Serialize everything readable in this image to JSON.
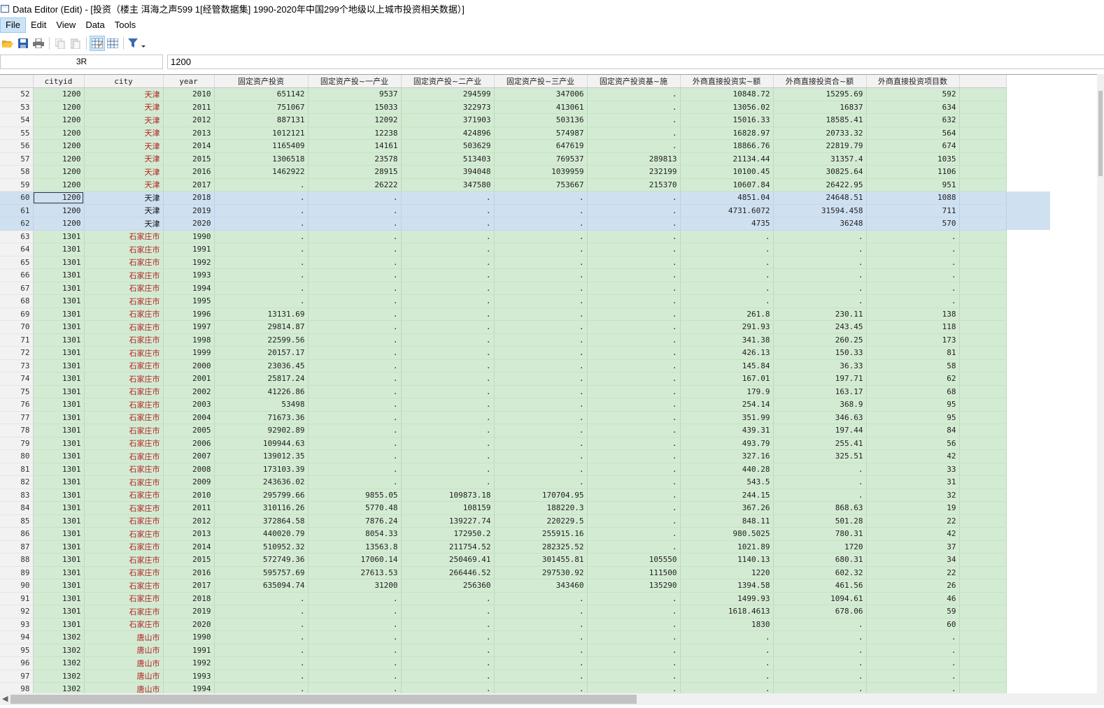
{
  "window": {
    "title": "Data Editor (Edit) - [投资（楼主 洱海之声599 1[经管数据集] 1990-2020年中国299个地级以上城市投资相关数据）]"
  },
  "menu": {
    "items": [
      "File",
      "Edit",
      "View",
      "Data",
      "Tools"
    ]
  },
  "toolbar": {
    "icons": [
      "open-icon",
      "save-icon",
      "print-icon",
      "copy-icon",
      "paste-icon",
      "data-editor-edit-icon",
      "data-editor-browse-icon",
      "filter-icon"
    ]
  },
  "cell": {
    "ref": "3R",
    "value": "1200"
  },
  "columns": [
    "cityid",
    "city",
    "year",
    "固定资产投资",
    "固定资产投~一产业",
    "固定资产投~二产业",
    "固定资产投~三产业",
    "固定资产投资基~施",
    "外商直接投资实~额",
    "外商直接投资合~额",
    "外商直接投资项目数"
  ],
  "rows": [
    {
      "n": "52",
      "cells": [
        "1200",
        "天津",
        "2010",
        "651142",
        "9537",
        "294599",
        "347006",
        ".",
        "10848.72",
        "15295.69",
        "592"
      ]
    },
    {
      "n": "53",
      "cells": [
        "1200",
        "天津",
        "2011",
        "751067",
        "15033",
        "322973",
        "413061",
        ".",
        "13056.02",
        "16837",
        "634"
      ]
    },
    {
      "n": "54",
      "cells": [
        "1200",
        "天津",
        "2012",
        "887131",
        "12092",
        "371903",
        "503136",
        ".",
        "15016.33",
        "18585.41",
        "632"
      ]
    },
    {
      "n": "55",
      "cells": [
        "1200",
        "天津",
        "2013",
        "1012121",
        "12238",
        "424896",
        "574987",
        ".",
        "16828.97",
        "20733.32",
        "564"
      ]
    },
    {
      "n": "56",
      "cells": [
        "1200",
        "天津",
        "2014",
        "1165409",
        "14161",
        "503629",
        "647619",
        ".",
        "18866.76",
        "22819.79",
        "674"
      ]
    },
    {
      "n": "57",
      "cells": [
        "1200",
        "天津",
        "2015",
        "1306518",
        "23578",
        "513403",
        "769537",
        "289813",
        "21134.44",
        "31357.4",
        "1035"
      ]
    },
    {
      "n": "58",
      "cells": [
        "1200",
        "天津",
        "2016",
        "1462922",
        "28915",
        "394048",
        "1039959",
        "232199",
        "10100.45",
        "30825.64",
        "1106"
      ]
    },
    {
      "n": "59",
      "cells": [
        "1200",
        "天津",
        "2017",
        ".",
        "26222",
        "347580",
        "753667",
        "215370",
        "10607.84",
        "26422.95",
        "951"
      ]
    },
    {
      "n": "60",
      "sel": true,
      "cur": true,
      "cells": [
        "1200",
        "天津",
        "2018",
        ".",
        ".",
        ".",
        ".",
        ".",
        "4851.04",
        "24648.51",
        "1088"
      ]
    },
    {
      "n": "61",
      "sel": true,
      "cells": [
        "1200",
        "天津",
        "2019",
        ".",
        ".",
        ".",
        ".",
        ".",
        "4731.6072",
        "31594.458",
        "711"
      ]
    },
    {
      "n": "62",
      "sel": true,
      "cells": [
        "1200",
        "天津",
        "2020",
        ".",
        ".",
        ".",
        ".",
        ".",
        "4735",
        "36248",
        "570"
      ]
    },
    {
      "n": "63",
      "cells": [
        "1301",
        "石家庄市",
        "1990",
        ".",
        ".",
        ".",
        ".",
        ".",
        ".",
        ".",
        "."
      ]
    },
    {
      "n": "64",
      "cells": [
        "1301",
        "石家庄市",
        "1991",
        ".",
        ".",
        ".",
        ".",
        ".",
        ".",
        ".",
        "."
      ]
    },
    {
      "n": "65",
      "cells": [
        "1301",
        "石家庄市",
        "1992",
        ".",
        ".",
        ".",
        ".",
        ".",
        ".",
        ".",
        "."
      ]
    },
    {
      "n": "66",
      "cells": [
        "1301",
        "石家庄市",
        "1993",
        ".",
        ".",
        ".",
        ".",
        ".",
        ".",
        ".",
        "."
      ]
    },
    {
      "n": "67",
      "cells": [
        "1301",
        "石家庄市",
        "1994",
        ".",
        ".",
        ".",
        ".",
        ".",
        ".",
        ".",
        "."
      ]
    },
    {
      "n": "68",
      "cells": [
        "1301",
        "石家庄市",
        "1995",
        ".",
        ".",
        ".",
        ".",
        ".",
        ".",
        ".",
        "."
      ]
    },
    {
      "n": "69",
      "cells": [
        "1301",
        "石家庄市",
        "1996",
        "13131.69",
        ".",
        ".",
        ".",
        ".",
        "261.8",
        "230.11",
        "138"
      ]
    },
    {
      "n": "70",
      "cells": [
        "1301",
        "石家庄市",
        "1997",
        "29814.87",
        ".",
        ".",
        ".",
        ".",
        "291.93",
        "243.45",
        "118"
      ]
    },
    {
      "n": "71",
      "cells": [
        "1301",
        "石家庄市",
        "1998",
        "22599.56",
        ".",
        ".",
        ".",
        ".",
        "341.38",
        "260.25",
        "173"
      ]
    },
    {
      "n": "72",
      "cells": [
        "1301",
        "石家庄市",
        "1999",
        "20157.17",
        ".",
        ".",
        ".",
        ".",
        "426.13",
        "150.33",
        "81"
      ]
    },
    {
      "n": "73",
      "cells": [
        "1301",
        "石家庄市",
        "2000",
        "23036.45",
        ".",
        ".",
        ".",
        ".",
        "145.84",
        "36.33",
        "58"
      ]
    },
    {
      "n": "74",
      "cells": [
        "1301",
        "石家庄市",
        "2001",
        "25817.24",
        ".",
        ".",
        ".",
        ".",
        "167.01",
        "197.71",
        "62"
      ]
    },
    {
      "n": "75",
      "cells": [
        "1301",
        "石家庄市",
        "2002",
        "41226.86",
        ".",
        ".",
        ".",
        ".",
        "179.9",
        "163.17",
        "68"
      ]
    },
    {
      "n": "76",
      "cells": [
        "1301",
        "石家庄市",
        "2003",
        "53498",
        ".",
        ".",
        ".",
        ".",
        "254.14",
        "368.9",
        "95"
      ]
    },
    {
      "n": "77",
      "cells": [
        "1301",
        "石家庄市",
        "2004",
        "71673.36",
        ".",
        ".",
        ".",
        ".",
        "351.99",
        "346.63",
        "95"
      ]
    },
    {
      "n": "78",
      "cells": [
        "1301",
        "石家庄市",
        "2005",
        "92902.89",
        ".",
        ".",
        ".",
        ".",
        "439.31",
        "197.44",
        "84"
      ]
    },
    {
      "n": "79",
      "cells": [
        "1301",
        "石家庄市",
        "2006",
        "109944.63",
        ".",
        ".",
        ".",
        ".",
        "493.79",
        "255.41",
        "56"
      ]
    },
    {
      "n": "80",
      "cells": [
        "1301",
        "石家庄市",
        "2007",
        "139012.35",
        ".",
        ".",
        ".",
        ".",
        "327.16",
        "325.51",
        "42"
      ]
    },
    {
      "n": "81",
      "cells": [
        "1301",
        "石家庄市",
        "2008",
        "173103.39",
        ".",
        ".",
        ".",
        ".",
        "440.28",
        ".",
        "33"
      ]
    },
    {
      "n": "82",
      "cells": [
        "1301",
        "石家庄市",
        "2009",
        "243636.02",
        ".",
        ".",
        ".",
        ".",
        "543.5",
        ".",
        "31"
      ]
    },
    {
      "n": "83",
      "cells": [
        "1301",
        "石家庄市",
        "2010",
        "295799.66",
        "9855.05",
        "109873.18",
        "170704.95",
        ".",
        "244.15",
        ".",
        "32"
      ]
    },
    {
      "n": "84",
      "cells": [
        "1301",
        "石家庄市",
        "2011",
        "310116.26",
        "5770.48",
        "108159",
        "188220.3",
        ".",
        "367.26",
        "868.63",
        "19"
      ]
    },
    {
      "n": "85",
      "cells": [
        "1301",
        "石家庄市",
        "2012",
        "372864.58",
        "7876.24",
        "139227.74",
        "220229.5",
        ".",
        "848.11",
        "501.28",
        "22"
      ]
    },
    {
      "n": "86",
      "cells": [
        "1301",
        "石家庄市",
        "2013",
        "440020.79",
        "8054.33",
        "172950.2",
        "255915.16",
        ".",
        "980.5025",
        "780.31",
        "42"
      ]
    },
    {
      "n": "87",
      "cells": [
        "1301",
        "石家庄市",
        "2014",
        "510952.32",
        "13563.8",
        "211754.52",
        "282325.52",
        ".",
        "1021.89",
        "1720",
        "37"
      ]
    },
    {
      "n": "88",
      "cells": [
        "1301",
        "石家庄市",
        "2015",
        "572749.36",
        "17060.14",
        "250469.41",
        "301455.81",
        "105550",
        "1140.13",
        "680.31",
        "34"
      ]
    },
    {
      "n": "89",
      "cells": [
        "1301",
        "石家庄市",
        "2016",
        "595757.69",
        "27613.53",
        "266446.52",
        "297530.92",
        "111500",
        "1220",
        "602.32",
        "22"
      ]
    },
    {
      "n": "90",
      "cells": [
        "1301",
        "石家庄市",
        "2017",
        "635094.74",
        "31200",
        "256360",
        "343460",
        "135290",
        "1394.58",
        "461.56",
        "26"
      ]
    },
    {
      "n": "91",
      "cells": [
        "1301",
        "石家庄市",
        "2018",
        ".",
        ".",
        ".",
        ".",
        ".",
        "1499.93",
        "1094.61",
        "46"
      ]
    },
    {
      "n": "92",
      "cells": [
        "1301",
        "石家庄市",
        "2019",
        ".",
        ".",
        ".",
        ".",
        ".",
        "1618.4613",
        "678.06",
        "59"
      ]
    },
    {
      "n": "93",
      "cells": [
        "1301",
        "石家庄市",
        "2020",
        ".",
        ".",
        ".",
        ".",
        ".",
        "1830",
        ".",
        "60"
      ]
    },
    {
      "n": "94",
      "cells": [
        "1302",
        "唐山市",
        "1990",
        ".",
        ".",
        ".",
        ".",
        ".",
        ".",
        ".",
        "."
      ]
    },
    {
      "n": "95",
      "cells": [
        "1302",
        "唐山市",
        "1991",
        ".",
        ".",
        ".",
        ".",
        ".",
        ".",
        ".",
        "."
      ]
    },
    {
      "n": "96",
      "cells": [
        "1302",
        "唐山市",
        "1992",
        ".",
        ".",
        ".",
        ".",
        ".",
        ".",
        ".",
        "."
      ]
    },
    {
      "n": "97",
      "cells": [
        "1302",
        "唐山市",
        "1993",
        ".",
        ".",
        ".",
        ".",
        ".",
        ".",
        ".",
        "."
      ]
    },
    {
      "n": "98",
      "cells": [
        "1302",
        "唐山市",
        "1994",
        ".",
        ".",
        ".",
        ".",
        ".",
        ".",
        ".",
        "."
      ]
    }
  ]
}
